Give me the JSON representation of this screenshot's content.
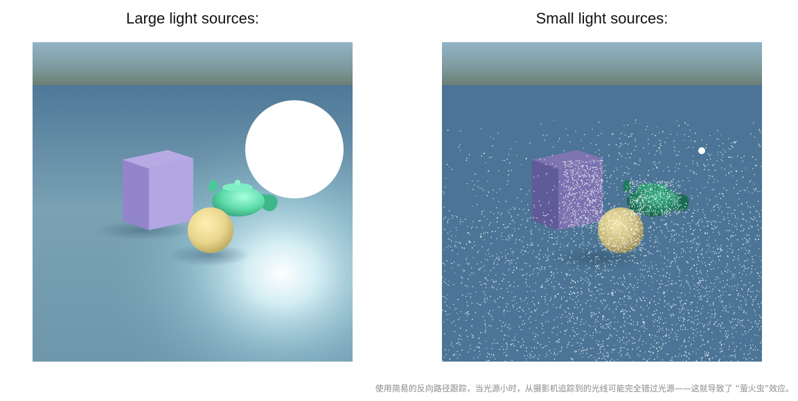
{
  "panels": [
    {
      "title": "Large light sources:"
    },
    {
      "title": "Small light sources:"
    }
  ],
  "caption": "使用简易的反向路径跟踪，当光源小时，从摄影机追踪到的光线可能完全错过光源——这就导致了 “萤火虫”效应。",
  "colors": {
    "sky_top": "#8fb0c4",
    "horizon": "#6f8078",
    "ground": "#4a7395",
    "cube": "#a89ad6",
    "teapot": "#57d6a4",
    "sphere": "#e8d890",
    "light": "#ffffff"
  }
}
